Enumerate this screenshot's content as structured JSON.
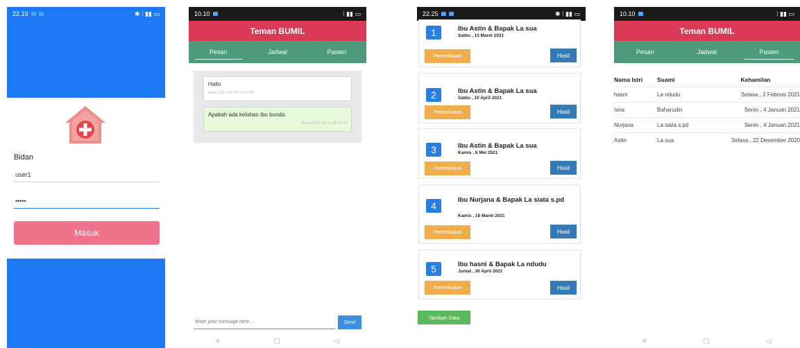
{
  "screens": {
    "login": {
      "status_time": "22.19",
      "label": "Bidan",
      "username_value": "user1",
      "password_value": "•••••",
      "login_button": "Masuk"
    },
    "chat": {
      "status_time": "10.10",
      "app_title": "Teman BUMIL",
      "tabs": [
        "Pesan",
        "Jadwal",
        "Pasien"
      ],
      "messages": [
        {
          "text": "Hallo",
          "meta": "Hasa 2021-03-24 18:16:00"
        },
        {
          "text": "Apakah ada keluhan ibu bunda",
          "meta": "Asrat 2021-03-24 18:17:00"
        }
      ],
      "compose_placeholder": "Write your message here...",
      "send_label": "Send"
    },
    "schedule": {
      "status_time": "22.25",
      "items": [
        {
          "num": "1",
          "title": "Ibu Astin & Bapak La sua",
          "date": "Sabtu , 13 Maret 2021"
        },
        {
          "num": "2",
          "title": "Ibu Astin & Bapak La sua",
          "date": "Sabtu , 10 April 2021"
        },
        {
          "num": "3",
          "title": "Ibu Astin & Bapak La sua",
          "date": "Kamis , 6 Mei 2021"
        },
        {
          "num": "4",
          "title": "Ibu Nurjana & Bapak La siata s.pd",
          "date": "Kamis , 18 Maret 2021"
        },
        {
          "num": "5",
          "title": "Ibu hasni & Bapak La ndudu",
          "date": "Jumat , 30 April 2021"
        }
      ],
      "btn_periksa": "Pemeriksaan",
      "btn_hasil": "Hasil",
      "btn_tambah": "Tambah Data"
    },
    "patients": {
      "status_time": "10.10",
      "app_title": "Teman BUMIL",
      "tabs": [
        "Pesan",
        "Jadwal",
        "Pasien"
      ],
      "headers": [
        "Nama Istri",
        "Suami",
        "Kehamilan"
      ],
      "rows": [
        [
          "hasni",
          "La ndudu",
          "Selasa , 2 Februai 2021"
        ],
        [
          "Isna",
          "Baharudin",
          "Senin , 4 Januari 2021"
        ],
        [
          "Nurjana",
          "La siata s.pd",
          "Senin , 4 Januari 2021"
        ],
        [
          "Astin",
          "La sua",
          "Selasa , 22 Desember 2020"
        ]
      ]
    }
  },
  "colors": {
    "login_bg": "#1e7bf5",
    "appbar": "#d93a55",
    "tabs": "#4e9a7c",
    "masuk": "#f0738b",
    "pemeriksaan": "#f0ad4e",
    "hasil": "#337ab7",
    "tambah": "#5cb85c"
  }
}
